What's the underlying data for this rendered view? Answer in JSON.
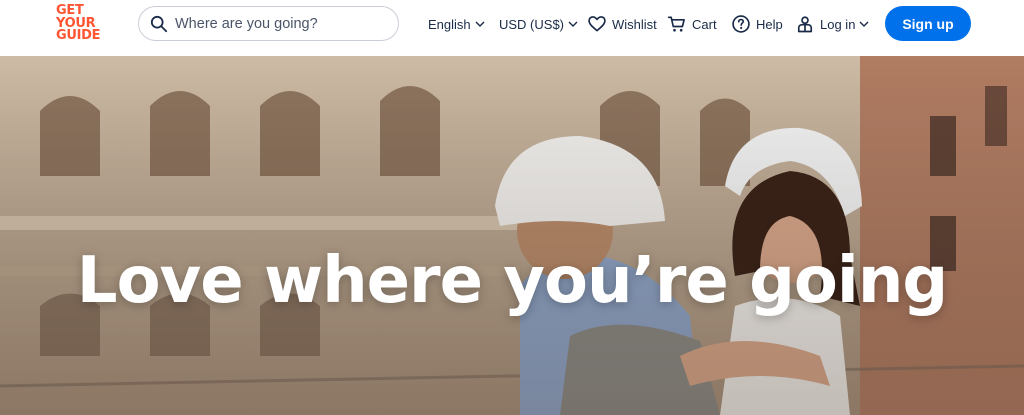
{
  "brand": {
    "logo_lines": [
      "GET",
      "YOUR",
      "GUIDE"
    ],
    "color": "#ff5533"
  },
  "search": {
    "placeholder": "Where are you going?",
    "value": ""
  },
  "nav": {
    "language": "English",
    "currency": "USD (US$)",
    "wishlist": "Wishlist",
    "cart": "Cart",
    "help": "Help",
    "login": "Log in",
    "signup": "Sign up"
  },
  "hero": {
    "headline": "Love where you’re going"
  },
  "colors": {
    "accent": "#0071eb",
    "text": "#1a2b49"
  }
}
